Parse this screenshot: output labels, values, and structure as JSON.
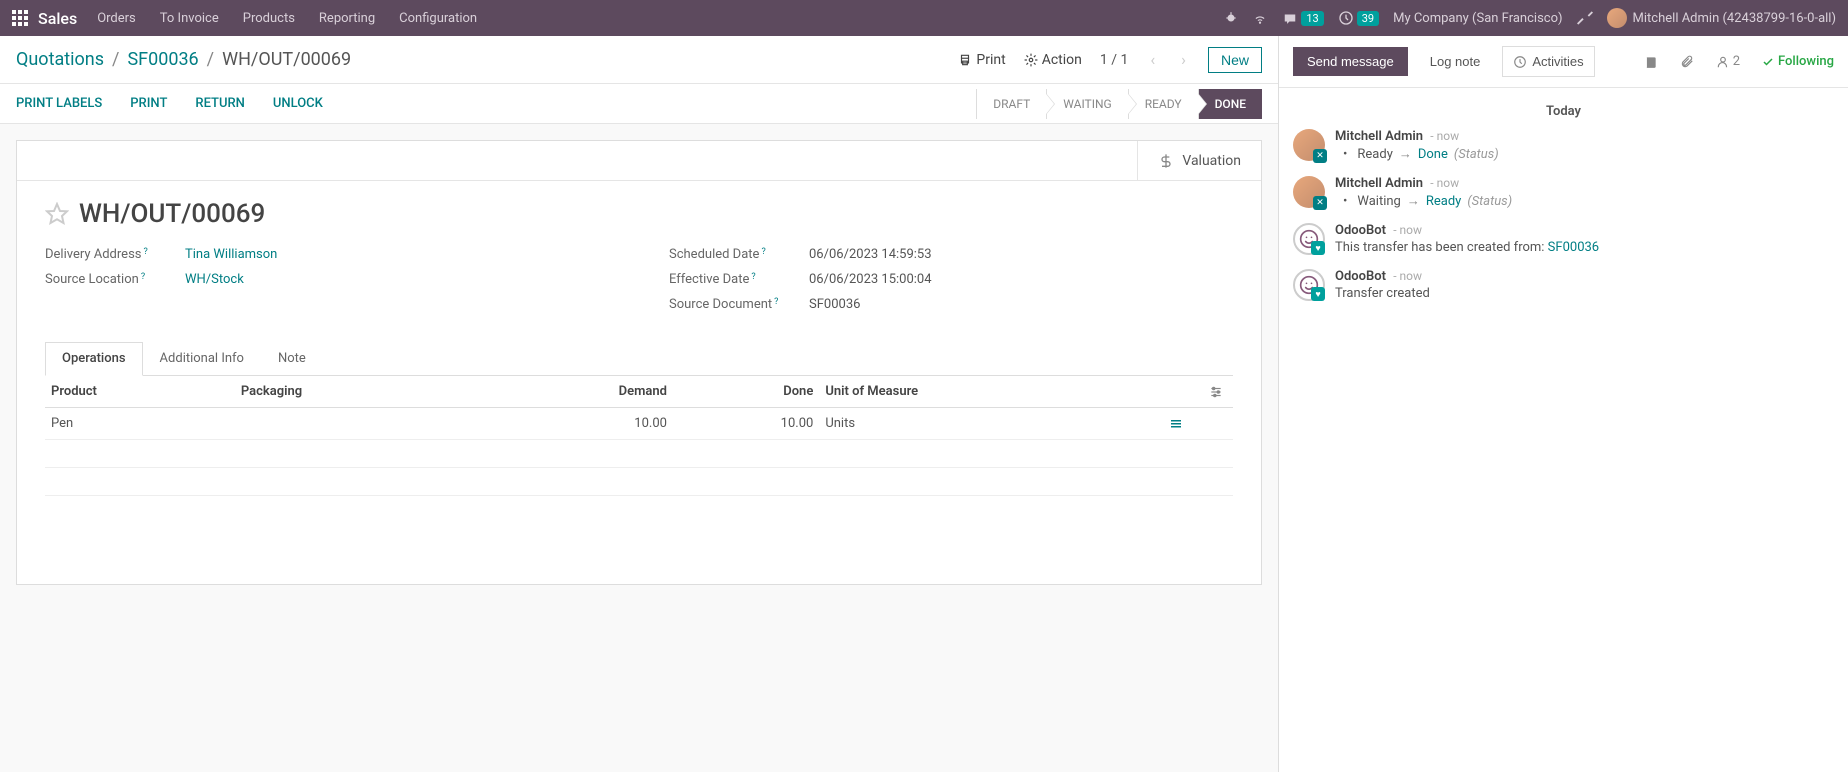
{
  "nav": {
    "app": "Sales",
    "links": [
      "Orders",
      "To Invoice",
      "Products",
      "Reporting",
      "Configuration"
    ],
    "msg_badge": "13",
    "clock_badge": "39",
    "company": "My Company (San Francisco)",
    "user": "Mitchell Admin (42438799-16-0-all)"
  },
  "breadcrumb": {
    "items": [
      "Quotations",
      "SF00036",
      "WH/OUT/00069"
    ],
    "print": "Print",
    "action": "Action",
    "pager": "1 / 1",
    "new": "New"
  },
  "toolbar": {
    "print_labels": "PRINT LABELS",
    "print": "PRINT",
    "return": "RETURN",
    "unlock": "UNLOCK",
    "steps": [
      "DRAFT",
      "WAITING",
      "READY",
      "DONE"
    ]
  },
  "sheet": {
    "valuation": "Valuation",
    "title": "WH/OUT/00069",
    "fields": {
      "delivery_address_label": "Delivery Address",
      "delivery_address": "Tina Williamson",
      "source_location_label": "Source Location",
      "source_location": "WH/Stock",
      "scheduled_date_label": "Scheduled Date",
      "scheduled_date": "06/06/2023 14:59:53",
      "effective_date_label": "Effective Date",
      "effective_date": "06/06/2023 15:00:04",
      "source_document_label": "Source Document",
      "source_document": "SF00036"
    },
    "tabs": [
      "Operations",
      "Additional Info",
      "Note"
    ],
    "table": {
      "headers": {
        "product": "Product",
        "packaging": "Packaging",
        "demand": "Demand",
        "done": "Done",
        "uom": "Unit of Measure"
      },
      "rows": [
        {
          "product": "Pen",
          "packaging": "",
          "demand": "10.00",
          "done": "10.00",
          "uom": "Units"
        }
      ]
    }
  },
  "chatter": {
    "send": "Send message",
    "log": "Log note",
    "activities": "Activities",
    "followers": "2",
    "following": "Following",
    "today": "Today",
    "messages": [
      {
        "author": "Mitchell Admin",
        "time": "now",
        "type": "change",
        "from": "Ready",
        "to": "Done",
        "field": "(Status)",
        "avatar": "user"
      },
      {
        "author": "Mitchell Admin",
        "time": "now",
        "type": "change",
        "from": "Waiting",
        "to": "Ready",
        "field": "(Status)",
        "avatar": "user"
      },
      {
        "author": "OdooBot",
        "time": "now",
        "type": "text",
        "text": "This transfer has been created from: ",
        "link": "SF00036",
        "avatar": "bot"
      },
      {
        "author": "OdooBot",
        "time": "now",
        "type": "text",
        "text": "Transfer created",
        "avatar": "bot"
      }
    ]
  }
}
